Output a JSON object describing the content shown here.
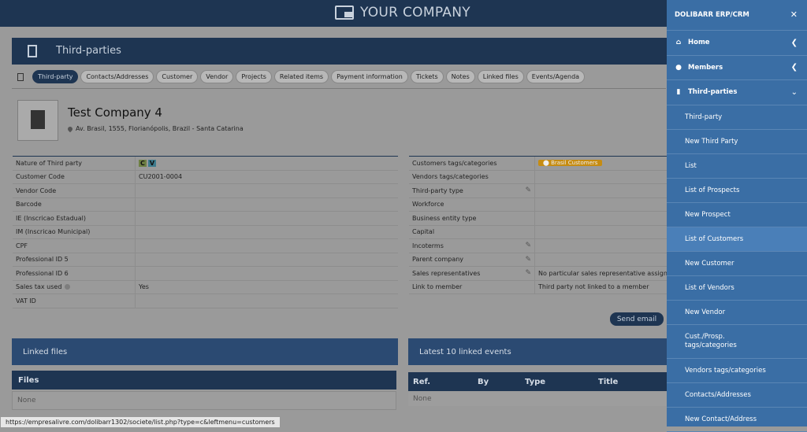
{
  "topbar": {
    "company": "YOUR COMPANY"
  },
  "page": {
    "title": "Third-parties"
  },
  "tabs": [
    "Third-party",
    "Contacts/Addresses",
    "Customer",
    "Vendor",
    "Projects",
    "Related items",
    "Payment information",
    "Tickets",
    "Notes",
    "Linked files",
    "Events/Agenda"
  ],
  "company": {
    "name": "Test Company 4",
    "address": "Av. Brasil, 1555, Florianópolis, Brazil - Santa Catarina"
  },
  "left_fields": [
    {
      "label": "Nature of Third party",
      "value": ""
    },
    {
      "label": "Customer Code",
      "value": "CU2001-0004"
    },
    {
      "label": "Vendor Code",
      "value": ""
    },
    {
      "label": "Barcode",
      "value": ""
    },
    {
      "label": "IE (Inscricao Estadual)",
      "value": ""
    },
    {
      "label": "IM (Inscricao Municipal)",
      "value": ""
    },
    {
      "label": "CPF",
      "value": ""
    },
    {
      "label": "Professional ID 5",
      "value": ""
    },
    {
      "label": "Professional ID 6",
      "value": ""
    },
    {
      "label": "Sales tax used",
      "value": "Yes"
    },
    {
      "label": "VAT ID",
      "value": ""
    }
  ],
  "nature_badges": [
    "C",
    "V"
  ],
  "right_fields": [
    {
      "label": "Customers tags/categories",
      "value": ""
    },
    {
      "label": "Vendors tags/categories",
      "value": ""
    },
    {
      "label": "Third-party type",
      "value": ""
    },
    {
      "label": "Workforce",
      "value": ""
    },
    {
      "label": "Business entity type",
      "value": ""
    },
    {
      "label": "Capital",
      "value": ""
    },
    {
      "label": "Incoterms",
      "value": ""
    },
    {
      "label": "Parent company",
      "value": ""
    },
    {
      "label": "Sales representatives",
      "value": "No particular sales representative assigned"
    },
    {
      "label": "Link to member",
      "value": "Third party not linked to a member"
    }
  ],
  "customer_tag": "Brasil Customers",
  "send_email": "Send email",
  "linked_files": {
    "title": "Linked files",
    "sub": "Files",
    "none": "None"
  },
  "events": {
    "title": "Latest 10 linked events",
    "cols": [
      "Ref.",
      "By",
      "Type",
      "Title"
    ],
    "none": "None"
  },
  "statusbar": "https://empresalivre.com/dolibarr1302/societe/list.php?type=c&leftmenu=customers",
  "menu": {
    "header": "DOLIBARR ERP/CRM",
    "top": [
      {
        "label": "Home",
        "icon": "home-icon"
      },
      {
        "label": "Members",
        "icon": "user-icon"
      },
      {
        "label": "Third-parties",
        "icon": "building-icon"
      }
    ],
    "sub": [
      "Third-party",
      "New Third Party",
      "List",
      "List of Prospects",
      "New Prospect",
      "List of Customers",
      "New Customer",
      "List of Vendors",
      "New Vendor",
      "Cust./Prosp. tags/categories",
      "Vendors tags/categories",
      "Contacts/Addresses",
      "New Contact/Address"
    ],
    "selected": "List of Customers"
  }
}
